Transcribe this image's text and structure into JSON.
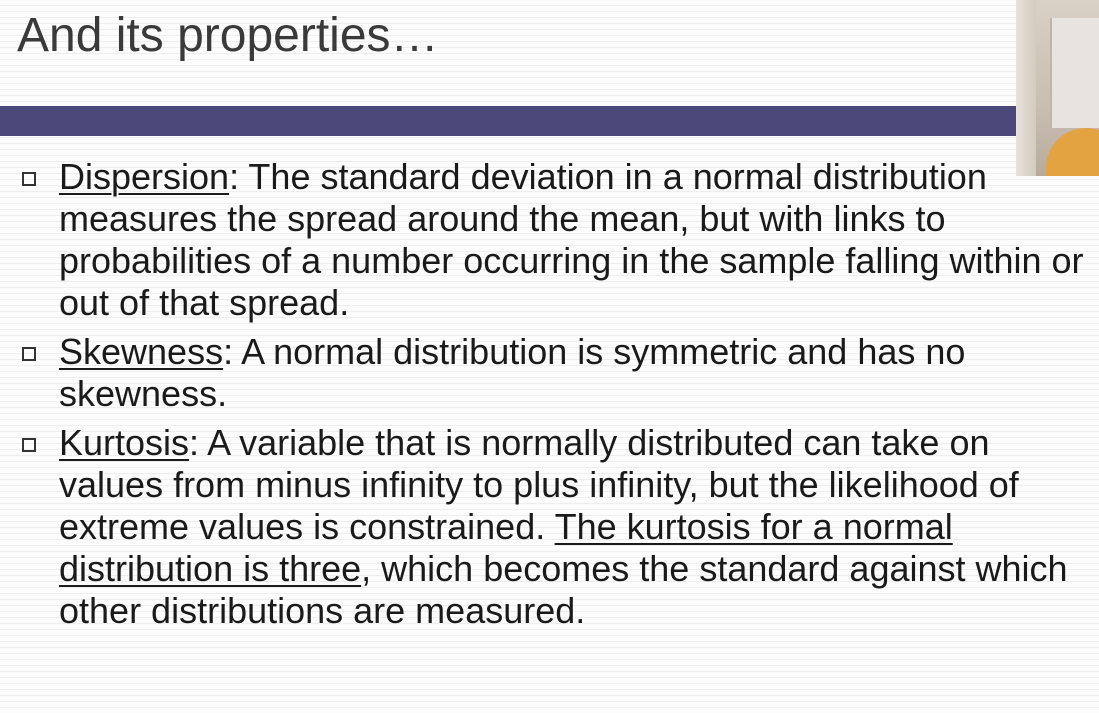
{
  "slide": {
    "title": "And its properties…",
    "bullets": [
      {
        "term": "Dispersion",
        "text": ": The standard deviation in a normal distribution measures the spread around the mean, but with links to probabilities of a number occurring in the sample falling within or out of that spread."
      },
      {
        "term": "Skewness",
        "text": ": A normal distribution is symmetric and has no skewness."
      },
      {
        "term": "Kurtosis",
        "text_before": ": A variable that is normally distributed can take on values from minus infinity to plus infinity, but the likelihood of extreme values is constrained. ",
        "emphasis": "The kurtosis for a normal distribution is three",
        "text_after": ", which becomes the standard against which other distributions are measured."
      }
    ]
  },
  "colors": {
    "title_bar": "#4a4878",
    "title_text": "#3a3a3a",
    "body_text": "#1a1a1a"
  }
}
